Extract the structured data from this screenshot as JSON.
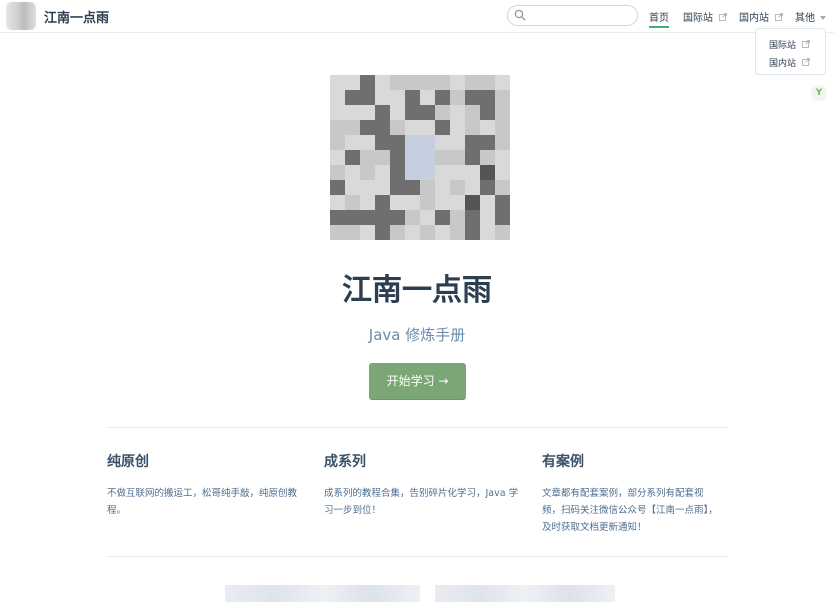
{
  "header": {
    "site_name": "江南一点雨",
    "search_placeholder": "",
    "nav": [
      {
        "label": "首页",
        "active": true
      },
      {
        "label": "国际站",
        "external": true
      },
      {
        "label": "国内站",
        "external": true
      },
      {
        "label": "其他",
        "dropdown": true
      }
    ],
    "dropdown_items": [
      "国际站",
      "国内站"
    ]
  },
  "hero": {
    "title": "江南一点雨",
    "description": "Java 修炼手册",
    "action_label": "开始学习 →"
  },
  "features": [
    {
      "title": "纯原创",
      "details": "不做互联网的搬运工，松哥纯手敲，纯原创教程。"
    },
    {
      "title": "成系列",
      "details": "成系列的教程合集，告别碎片化学习，Java 学习一步到位！"
    },
    {
      "title": "有案例",
      "details": "文章都有配套案例，部分系列有配套视频，扫码关注微信公众号【江南一点雨】，及时获取文档更新通知！"
    }
  ],
  "side_badge": "Y",
  "colors": {
    "accent": "#3eaf7c",
    "cta": "#7aa775",
    "text": "#2c3e50",
    "desc": "#6a8bad"
  },
  "icons": {
    "search": "search-icon",
    "external": "external-link-icon",
    "caret": "chevron-down-icon"
  }
}
